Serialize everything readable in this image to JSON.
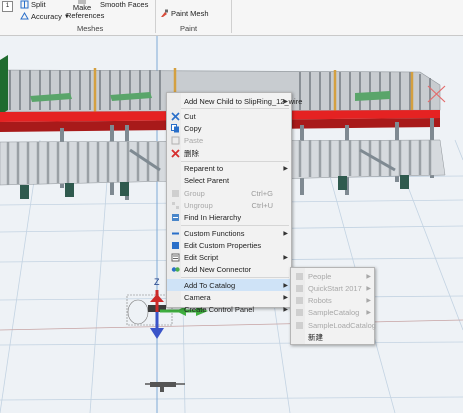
{
  "ribbon": {
    "small_box": "1",
    "split": "Split",
    "accuracy": "Accuracy",
    "make_refs_line1": "Make",
    "make_refs_line2": "References",
    "smooth_faces": "Smooth Faces",
    "meshes_group": "Meshes",
    "paint_mesh": "Paint Mesh",
    "paint_group": "Paint"
  },
  "axis_label": "Z",
  "context_menu": {
    "items": [
      {
        "label": "Add New Child to SlipRing_12_wire",
        "icon": "none",
        "arrow": true,
        "disabled": false
      },
      {
        "label": "Cut",
        "icon": "scissors-icon",
        "arrow": false,
        "disabled": false
      },
      {
        "label": "Copy",
        "icon": "copy-icon",
        "arrow": false,
        "disabled": false
      },
      {
        "label": "Paste",
        "icon": "paste-icon",
        "arrow": false,
        "disabled": true
      },
      {
        "label": "删除",
        "icon": "delete-icon",
        "arrow": false,
        "disabled": false
      },
      {
        "label": "Reparent to",
        "icon": "none",
        "arrow": true,
        "disabled": false
      },
      {
        "label": "Select Parent",
        "icon": "none",
        "arrow": false,
        "disabled": false
      },
      {
        "label": "Group",
        "shortcut": "Ctrl+G",
        "icon": "group-icon",
        "arrow": false,
        "disabled": true
      },
      {
        "label": "Ungroup",
        "shortcut": "Ctrl+U",
        "icon": "ungroup-icon",
        "arrow": false,
        "disabled": true
      },
      {
        "label": "Find In Hierarchy",
        "icon": "hierarchy-icon",
        "arrow": false,
        "disabled": false
      },
      {
        "label": "Custom Functions",
        "icon": "function-icon",
        "arrow": true,
        "disabled": false
      },
      {
        "label": "Edit Custom Properties",
        "icon": "properties-icon",
        "arrow": false,
        "disabled": false
      },
      {
        "label": "Edit Script",
        "icon": "script-icon",
        "arrow": true,
        "disabled": false
      },
      {
        "label": "Add New Connector",
        "icon": "connector-icon",
        "arrow": false,
        "disabled": false
      },
      {
        "label": "Add To Catalog",
        "icon": "none",
        "arrow": true,
        "disabled": false,
        "highlight": true
      },
      {
        "label": "Camera",
        "icon": "none",
        "arrow": true,
        "disabled": false
      },
      {
        "label": "Create Control Panel",
        "icon": "none",
        "arrow": true,
        "disabled": false
      }
    ]
  },
  "submenu": {
    "items": [
      {
        "label": "People",
        "arrow": true,
        "disabled": true
      },
      {
        "label": "QuickStart 2017",
        "arrow": true,
        "disabled": true
      },
      {
        "label": "Robots",
        "arrow": true,
        "disabled": true
      },
      {
        "label": "SampleCatalog",
        "arrow": true,
        "disabled": true
      },
      {
        "label": "SampleLoadCatalog",
        "arrow": false,
        "disabled": true
      },
      {
        "label": "新建",
        "arrow": false,
        "disabled": false
      }
    ]
  }
}
